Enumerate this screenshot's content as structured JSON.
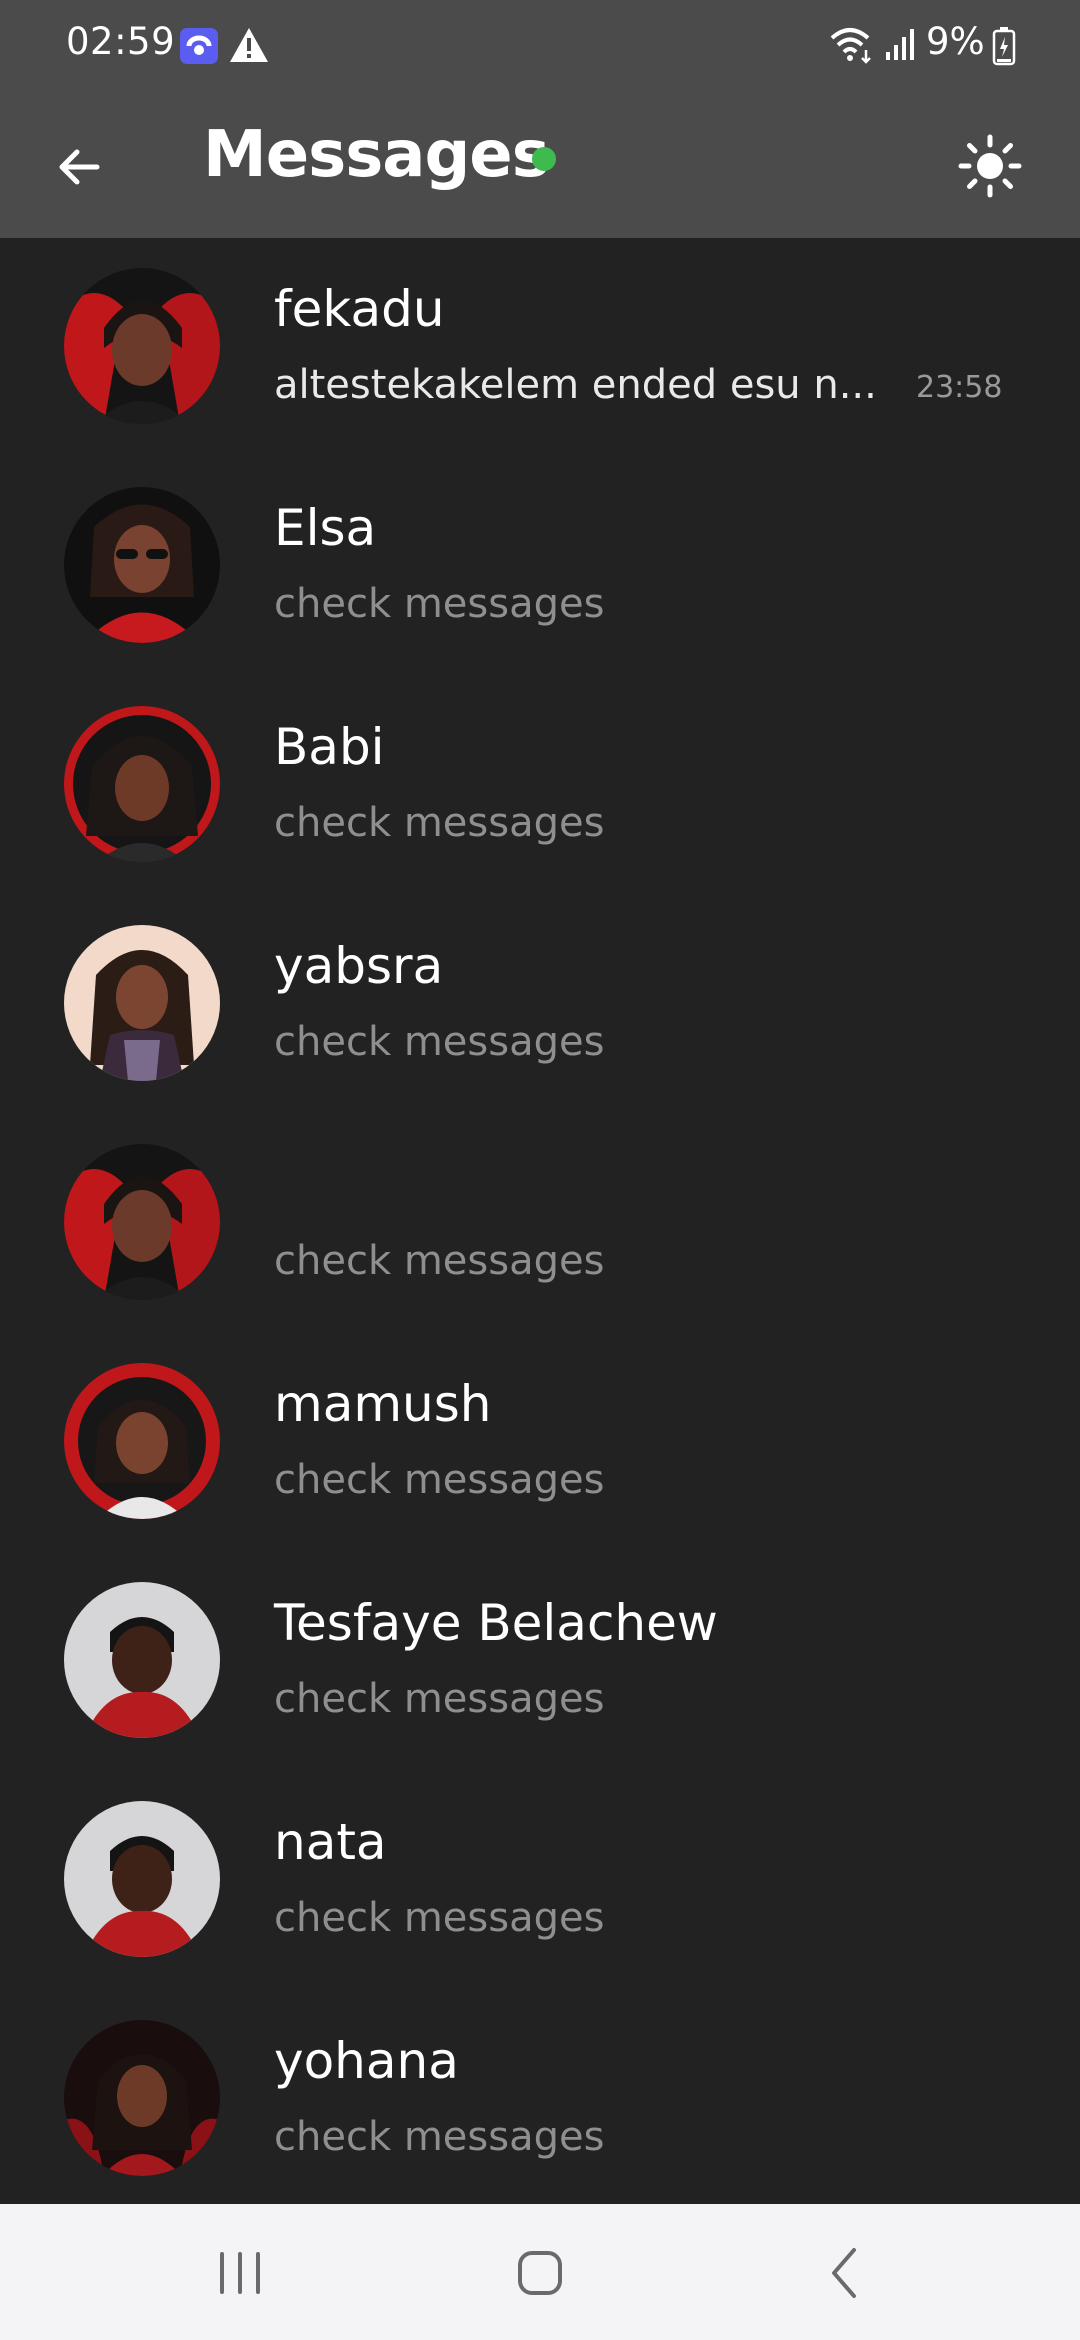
{
  "status_bar": {
    "time": "02:59",
    "battery": "9%",
    "icons": [
      "app-notification-icon",
      "alert-icon",
      "wifi-icon",
      "signal-icon",
      "battery-icon"
    ]
  },
  "app_bar": {
    "title": "Messages",
    "online_color": "#3dbb4e",
    "back_icon": "arrow-left-icon",
    "theme_icon": "sun-icon"
  },
  "chats": [
    {
      "name": "fekadu",
      "preview": "altestekakelem ended esu n...",
      "time": "23:58",
      "unread": true
    },
    {
      "name": "Elsa",
      "preview": "check messages"
    },
    {
      "name": "Babi",
      "preview": "check messages"
    },
    {
      "name": "yabsra",
      "preview": "check messages"
    },
    {
      "name": "",
      "preview": "check messages"
    },
    {
      "name": "mamush",
      "preview": "check messages"
    },
    {
      "name": "Tesfaye Belachew",
      "preview": "check messages"
    },
    {
      "name": "nata",
      "preview": "check messages"
    },
    {
      "name": "yohana",
      "preview": "check messages"
    }
  ],
  "nav_bar": {
    "icons": [
      "recent-apps-icon",
      "home-icon",
      "back-icon"
    ]
  },
  "colors": {
    "background": "#222223",
    "app_bar": "#4b4b4b",
    "nav_bar": "#f4f4f6",
    "preview_text": "#8f8f8f"
  }
}
